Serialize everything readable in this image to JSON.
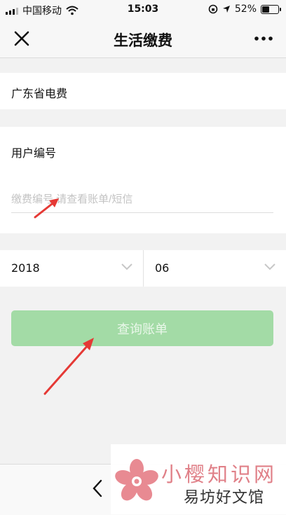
{
  "status_bar": {
    "carrier": "中国移动",
    "time": "15:03",
    "battery": "52%",
    "battery_level": 0.52
  },
  "nav": {
    "title": "生活缴费"
  },
  "province_fee": "广东省电费",
  "user": {
    "label": "用户编号",
    "placeholder": "缴费编号,请查看账单/短信",
    "value": ""
  },
  "date": {
    "year": "2018",
    "month": "06"
  },
  "query_button": "查询账单",
  "watermark": {
    "line1": "小樱知识网",
    "line2": "易坊好文馆"
  },
  "colors": {
    "accent_green": "#a3dba6",
    "arrow_red": "#e53935"
  }
}
